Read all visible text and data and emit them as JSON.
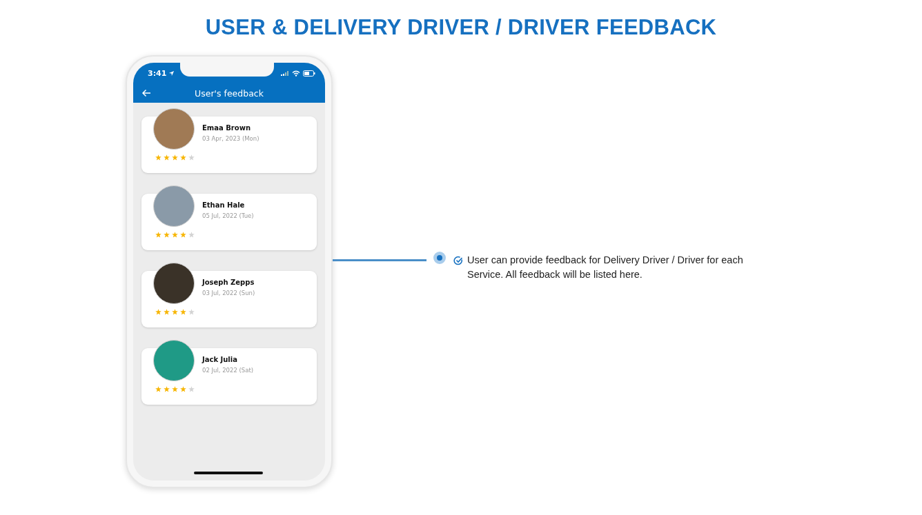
{
  "title": "USER & DELIVERY DRIVER / DRIVER FEEDBACK",
  "phone": {
    "status_bar": {
      "time": "3:41"
    },
    "header": {
      "title": "User's feedback"
    },
    "feedback": [
      {
        "name": "Emaa Brown",
        "date": "03 Apr, 2023 (Mon)",
        "stars": 4,
        "color": "#a07a55"
      },
      {
        "name": "Ethan Hale",
        "date": "05 Jul, 2022 (Tue)",
        "stars": 4,
        "color": "#8a9aa8"
      },
      {
        "name": "Joseph Zepps",
        "date": "03 Jul, 2022 (Sun)",
        "stars": 4,
        "color": "#3a3228"
      },
      {
        "name": "Jack Julia",
        "date": "02 Jul, 2022 (Sat)",
        "stars": 4,
        "color": "#1f9a86"
      }
    ]
  },
  "callout": {
    "text": "User can provide feedback for Delivery Driver / Driver for each Service. All feedback will be listed here."
  }
}
